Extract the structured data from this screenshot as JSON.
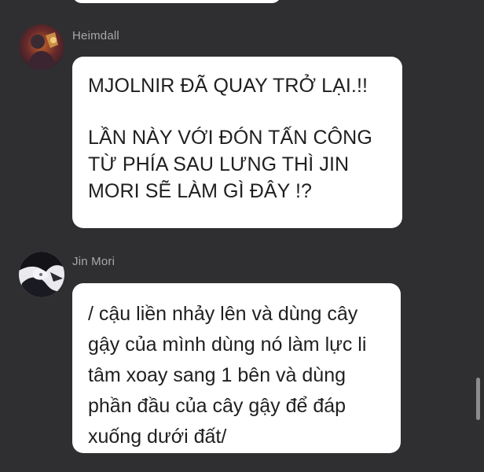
{
  "messages": [
    {
      "username": "Heimdall",
      "lines_a": [
        "MJOLNIR ĐÃ QUAY TRỞ LẠI.!!"
      ],
      "lines_b": [
        "LẦN NÀY VỚI ĐÓN TẤN CÔNG",
        "TỪ PHÍA SAU LƯNG THÌ JIN",
        "MORI SẼ LÀM GÌ ĐÂY !?"
      ]
    },
    {
      "username": "Jin Mori",
      "lines": [
        "/ cậu liền nhảy lên và dùng cây",
        "gậy của mình dùng nó làm lực li",
        "tâm xoay sang 1 bên và dùng",
        "phần đầu của cây gậy để đáp",
        "xuống dưới đất/"
      ]
    }
  ],
  "colors": {
    "background": "#2f2f31",
    "bubble": "#ffffff",
    "username": "#a9a9ab",
    "text": "#1f1f1f"
  },
  "icons": {
    "avatar_1": "heimdall-avatar",
    "avatar_2": "jin-mori-avatar"
  }
}
